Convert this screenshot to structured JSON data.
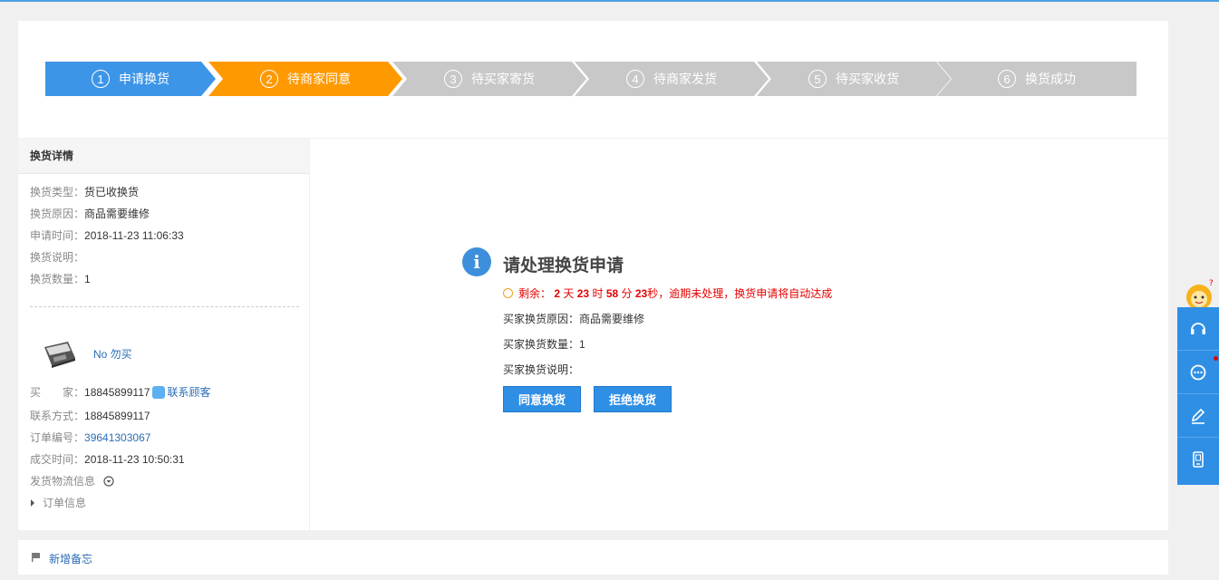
{
  "steps": [
    {
      "num": "1",
      "label": "申请换货"
    },
    {
      "num": "2",
      "label": "待商家同意"
    },
    {
      "num": "3",
      "label": "待买家寄货"
    },
    {
      "num": "4",
      "label": "待商家发货"
    },
    {
      "num": "5",
      "label": "待买家收货"
    },
    {
      "num": "6",
      "label": "换货成功"
    }
  ],
  "colors": {
    "active_done": "#3d95e8",
    "current": "#ff9900",
    "pending": "#c8c8c8",
    "accent": "#2f8fe5",
    "countdown": "#e60000"
  },
  "detail": {
    "title": "换货详情",
    "type_label": "换货类型：",
    "type_value": "货已收换货",
    "reason_label": "换货原因：",
    "reason_value": "商品需要维修",
    "time_label": "申请时间：",
    "time_value": "2018-11-23 11:06:33",
    "desc_label": "换货说明：",
    "desc_value": "",
    "qty_label": "换货数量：",
    "qty_value": "1"
  },
  "product": {
    "name": "No 勿买"
  },
  "order": {
    "buyer_label": "买　　家：",
    "buyer_value": "18845899117",
    "contact_link": "联系顾客",
    "phone_label": "联系方式：",
    "phone_value": "18845899117",
    "order_no_label": "订单编号：",
    "order_no_value": "39641303067",
    "deal_time_label": "成交时间：",
    "deal_time_value": "2018-11-23 10:50:31",
    "logistics_label": "发货物流信息",
    "order_info_label": "订单信息"
  },
  "main": {
    "title": "请处理换货申请",
    "countdown_prefix": "剩余：",
    "days": "2",
    "days_unit": "天",
    "hours": "23",
    "hours_unit": "时",
    "minutes": "58",
    "minutes_unit": "分",
    "seconds": "23",
    "seconds_unit": "秒",
    "countdown_suffix": "，逾期未处理，换货申请将自动达成",
    "reason": "买家换货原因：商品需要维修",
    "qty": "买家换货数量：1",
    "desc": "买家换货说明：",
    "agree_button": "同意换货",
    "reject_button": "拒绝换货"
  },
  "memo": {
    "add_label": "新增备忘"
  },
  "sidebar_icons": [
    "headset-icon",
    "chat-icon",
    "edit-icon",
    "phone-icon"
  ]
}
